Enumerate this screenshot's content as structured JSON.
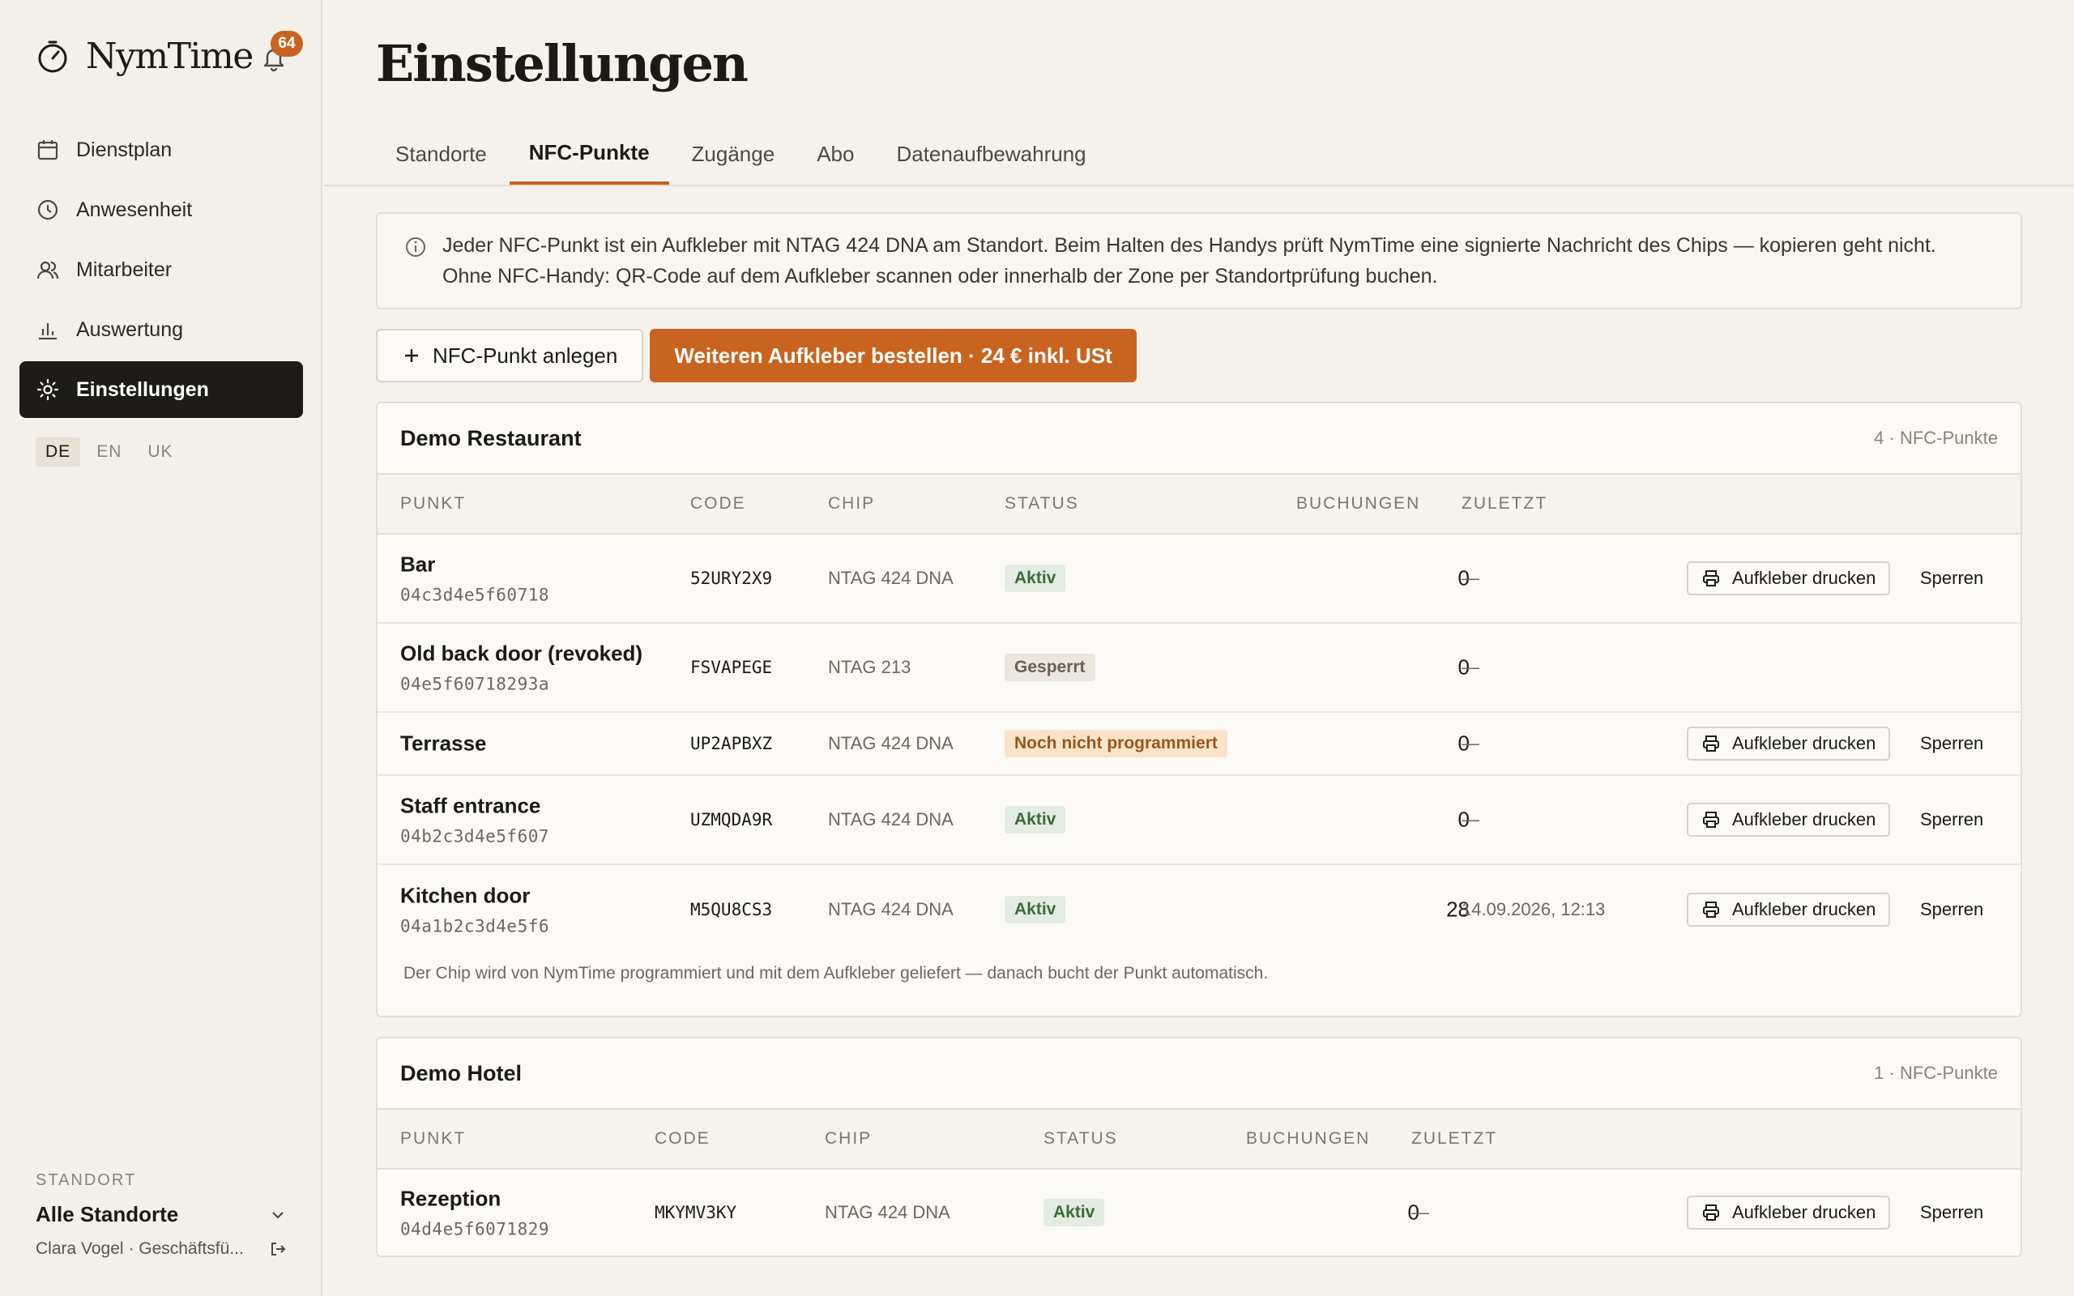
{
  "app": {
    "name": "NymTime",
    "notifications": "64"
  },
  "nav": [
    {
      "label": "Dienstplan",
      "icon": "calendar-icon"
    },
    {
      "label": "Anwesenheit",
      "icon": "clock-icon"
    },
    {
      "label": "Mitarbeiter",
      "icon": "users-icon"
    },
    {
      "label": "Auswertung",
      "icon": "chart-icon"
    },
    {
      "label": "Einstellungen",
      "icon": "gear-icon",
      "active": true
    }
  ],
  "languages": {
    "de": "DE",
    "en": "EN",
    "uk": "UK"
  },
  "location": {
    "label": "STANDORT",
    "value": "Alle Standorte",
    "user": "Clara Vogel · Geschäftsfü..."
  },
  "page": {
    "title": "Einstellungen"
  },
  "tabs": [
    "Standorte",
    "NFC-Punkte",
    "Zugänge",
    "Abo",
    "Datenaufbewahrung"
  ],
  "info": {
    "line1": "Jeder NFC-Punkt ist ein Aufkleber mit NTAG 424 DNA am Standort. Beim Halten des Handys prüft NymTime eine signierte Nachricht des Chips — kopieren geht nicht.",
    "line2": "Ohne NFC-Handy: QR-Code auf dem Aufkleber scannen oder innerhalb der Zone per Standortprüfung buchen."
  },
  "actions": {
    "add": "NFC-Punkt anlegen",
    "order": "Weiteren Aufkleber bestellen · 24 € inkl. USt"
  },
  "columns": {
    "punkt": "PUNKT",
    "code": "CODE",
    "chip": "CHIP",
    "status": "STATUS",
    "buchungen": "BUCHUNGEN",
    "zuletzt": "ZULETZT"
  },
  "row_actions": {
    "print": "Aufkleber drucken",
    "lock": "Sperren"
  },
  "sites": [
    {
      "name": "Demo Restaurant",
      "count": "4 · NFC-Punkte",
      "points": [
        {
          "name": "Bar",
          "uid": "04c3d4e5f60718",
          "code": "52URY2X9",
          "chip": "NTAG 424 DNA",
          "status": "Aktiv",
          "status_color": "#3d6b3a",
          "bookings": "0",
          "last": "—"
        },
        {
          "name": "Old back door (revoked)",
          "uid": "04e5f60718293a",
          "code": "FSVAPEGE",
          "chip": "NTAG 213",
          "status": "Gesperrt",
          "status_color": "#6a5f51",
          "bookings": "0",
          "last": "—"
        },
        {
          "name": "Terrasse",
          "uid": "",
          "code": "UP2APBXZ",
          "chip": "NTAG 424 DNA",
          "status": "Noch nicht programmiert",
          "status_color": "#98561c",
          "bookings": "0",
          "last": "—"
        },
        {
          "name": "Staff entrance",
          "uid": "04b2c3d4e5f607",
          "code": "UZMQDA9R",
          "chip": "NTAG 424 DNA",
          "status": "Aktiv",
          "status_color": "#3d6b3a",
          "bookings": "0",
          "last": "—"
        },
        {
          "name": "Kitchen door",
          "uid": "04a1b2c3d4e5f6",
          "code": "M5QU8CS3",
          "chip": "NTAG 424 DNA",
          "status": "Aktiv",
          "status_color": "#3d6b3a",
          "bookings": "28",
          "last": "14.09.2026, 12:13"
        }
      ],
      "footnote": "Der Chip wird von NymTime programmiert und mit dem Aufkleber geliefert — danach bucht der Punkt automatisch."
    },
    {
      "name": "Demo Hotel",
      "count": "1 · NFC-Punkte",
      "points": [
        {
          "name": "Rezeption",
          "uid": "04d4e5f6071829",
          "code": "MKYMV3KY",
          "chip": "NTAG 424 DNA",
          "status": "Aktiv",
          "status_color": "#3d6b3a",
          "bookings": "0",
          "last": "—"
        }
      ]
    }
  ],
  "colors": {
    "accent": "#c8641f",
    "sidebar_active": "#1e1c18",
    "background": "#f5f2ec"
  }
}
